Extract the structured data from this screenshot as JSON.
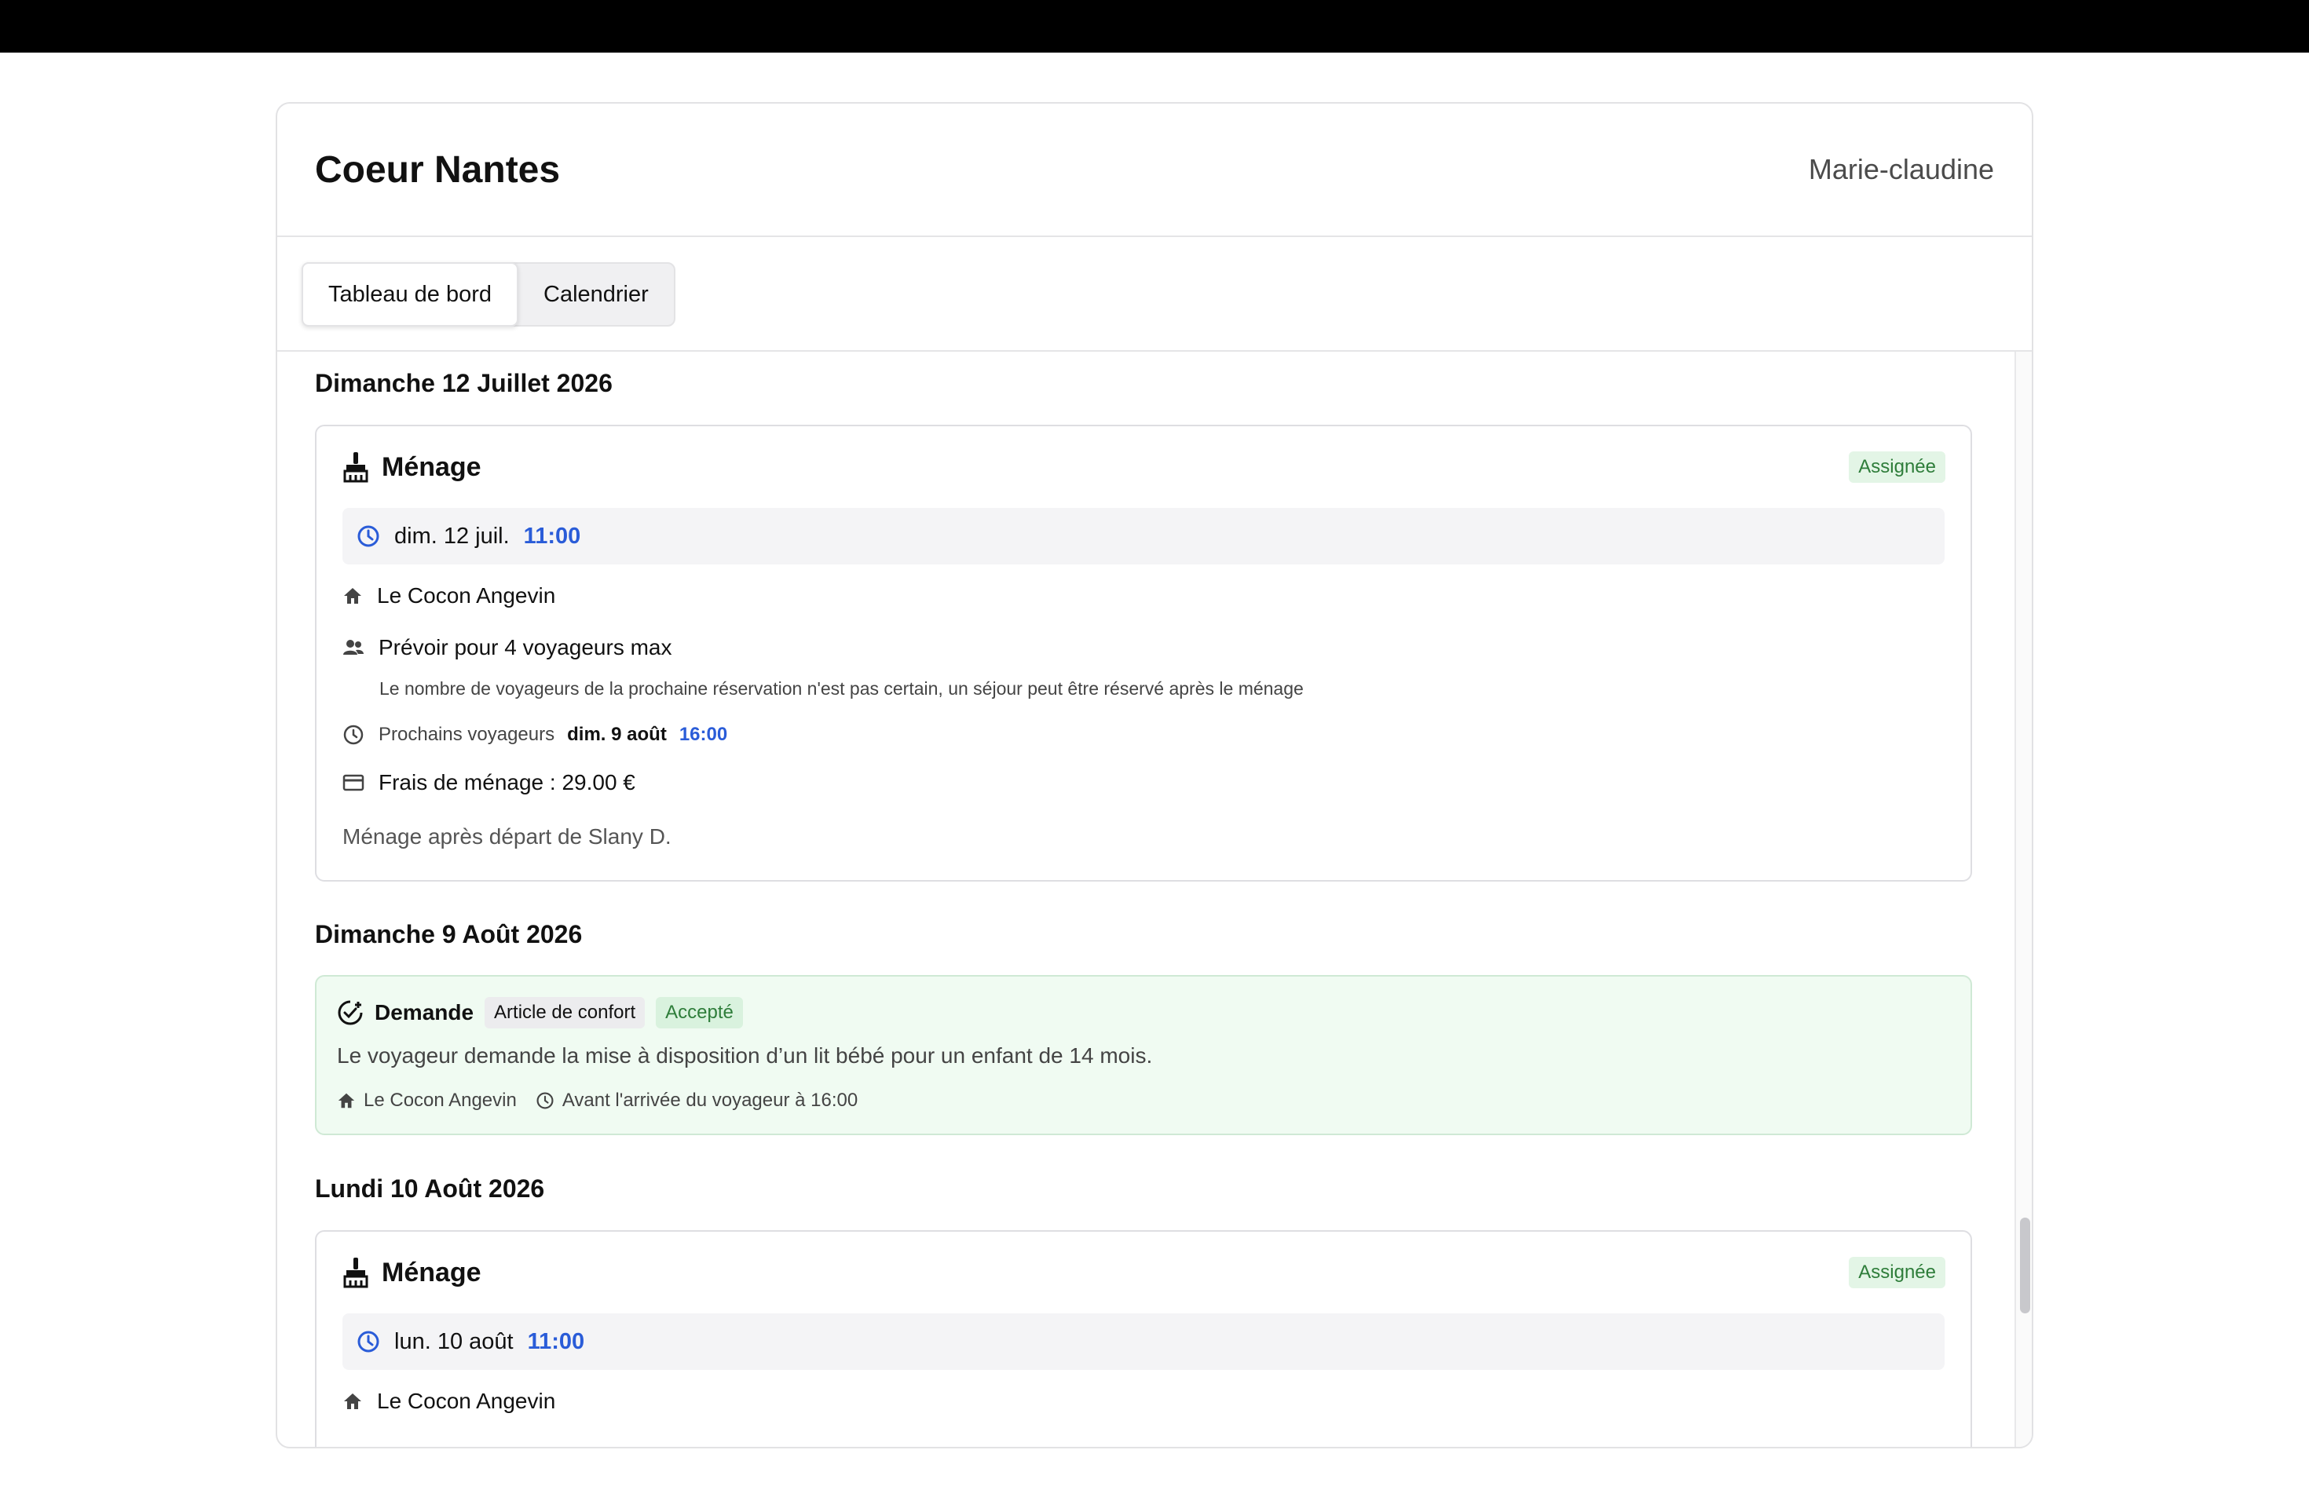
{
  "header": {
    "brand": "Coeur Nantes",
    "user": "Marie-claudine"
  },
  "tabs": [
    {
      "label": "Tableau de bord",
      "active": true
    },
    {
      "label": "Calendrier",
      "active": false
    }
  ],
  "colors": {
    "accent_blue": "#2a5cd8",
    "status_green": "#2e7d3a",
    "request_bg": "#f0fbf2"
  },
  "days": [
    {
      "title": "Dimanche 12 Juillet 2026",
      "task": {
        "icon": "broom-icon",
        "title": "Ménage",
        "status": "Assignée",
        "date": "dim. 12 juil.",
        "time": "11:00",
        "property": "Le Cocon Angevin",
        "guests": "Prévoir pour 4 voyageurs max",
        "guests_note": "Le nombre de voyageurs de la prochaine réservation n'est pas certain, un séjour peut être réservé après le ménage",
        "next_label": "Prochains voyageurs",
        "next_date": "dim. 9 août",
        "next_time": "16:00",
        "fee": "Frais de ménage : 29.00 €",
        "note": "Ménage après départ de Slany D."
      }
    },
    {
      "title": "Dimanche 9 Août 2026",
      "request": {
        "icon": "badge-check-icon",
        "title": "Demande",
        "category": "Article de confort",
        "status": "Accepté",
        "text": "Le voyageur demande la mise à disposition d’un lit bébé pour un enfant de 14 mois.",
        "property": "Le Cocon Angevin",
        "timing": "Avant l'arrivée du voyageur à 16:00"
      }
    },
    {
      "title": "Lundi 10 Août 2026",
      "task": {
        "icon": "broom-icon",
        "title": "Ménage",
        "status": "Assignée",
        "date": "lun. 10 août",
        "time": "11:00",
        "property": "Le Cocon Angevin"
      }
    }
  ]
}
